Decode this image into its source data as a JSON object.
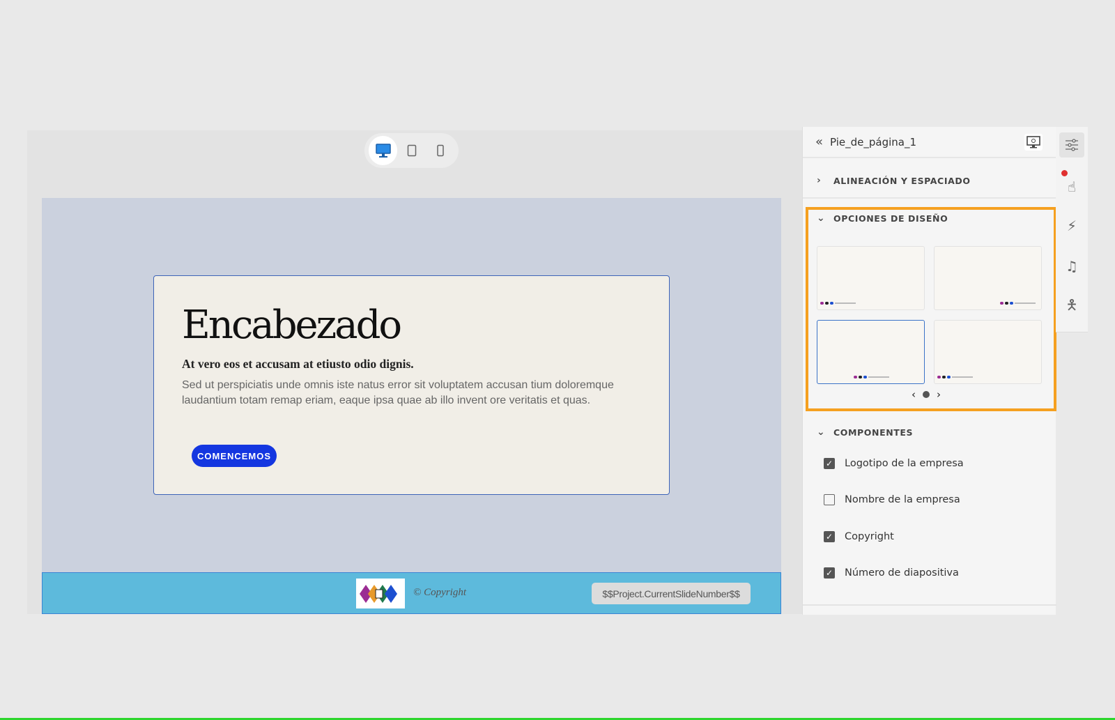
{
  "toolbar": {
    "devices": [
      "desktop",
      "tablet",
      "mobile"
    ],
    "active": "desktop"
  },
  "slide": {
    "heading": "Encabezado",
    "subheading": "At vero eos et accusam at etiusto odio dignis.",
    "body": "Sed ut perspiciatis unde omnis iste natus error sit voluptatem accusan tium doloremque laudantium totam remap eriam, eaque ipsa quae ab illo invent ore veritatis et quas.",
    "cta": "COMENCEMOS",
    "footer": {
      "copyright": "© Copyright",
      "slide_number": "$$Project.CurrentSlideNumber$$"
    }
  },
  "panel": {
    "title": "Pie_de_página_1",
    "sections": {
      "alignment": "ALINEACIÓN Y ESPACIADO",
      "design": "OPCIONES DE DISEÑO",
      "components": "COMPONENTES"
    },
    "design_selected_index": 2,
    "carousel_page": 1,
    "components": [
      {
        "label": "Logotipo de la empresa",
        "checked": true
      },
      {
        "label": "Nombre de la empresa",
        "checked": false
      },
      {
        "label": "Copyright",
        "checked": true
      },
      {
        "label": "Número de diapositiva",
        "checked": true
      }
    ]
  },
  "colors": {
    "accent": "#f5a020",
    "footer": "#5dbadc",
    "cta": "#1436e0"
  }
}
